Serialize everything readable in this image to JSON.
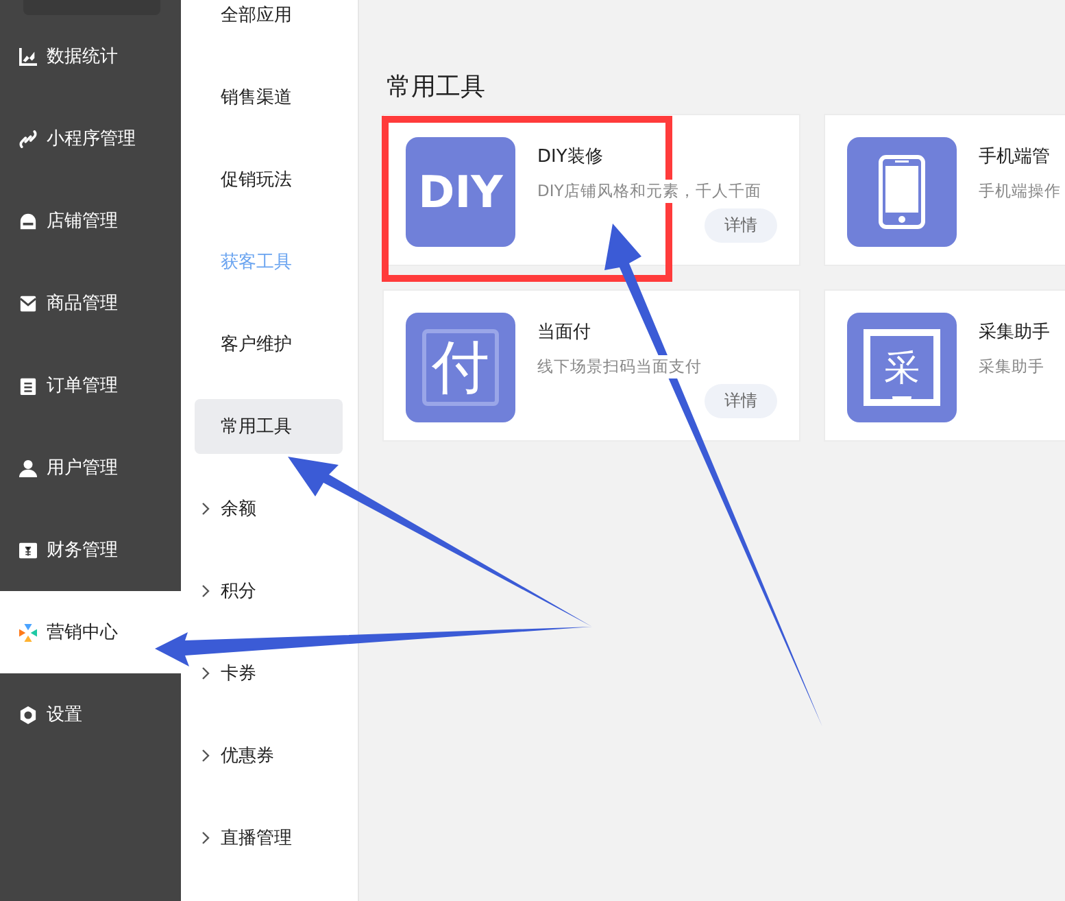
{
  "sidebar": {
    "items": [
      {
        "label": "数据统计",
        "selected": false
      },
      {
        "label": "小程序管理",
        "selected": false
      },
      {
        "label": "店铺管理",
        "selected": false
      },
      {
        "label": "商品管理",
        "selected": false
      },
      {
        "label": "订单管理",
        "selected": false
      },
      {
        "label": "用户管理",
        "selected": false
      },
      {
        "label": "财务管理",
        "selected": false
      },
      {
        "label": "营销中心",
        "selected": true
      },
      {
        "label": "设置",
        "selected": false
      }
    ]
  },
  "submenu": {
    "items": [
      {
        "label": "全部应用",
        "kind": "link",
        "selected": false,
        "highlighted": false
      },
      {
        "label": "销售渠道",
        "kind": "link",
        "selected": false,
        "highlighted": false
      },
      {
        "label": "促销玩法",
        "kind": "link",
        "selected": false,
        "highlighted": false
      },
      {
        "label": "获客工具",
        "kind": "link",
        "selected": false,
        "highlighted": true
      },
      {
        "label": "客户维护",
        "kind": "link",
        "selected": false,
        "highlighted": false
      },
      {
        "label": "常用工具",
        "kind": "link",
        "selected": true,
        "highlighted": false
      },
      {
        "label": "余额",
        "kind": "group",
        "selected": false,
        "highlighted": false
      },
      {
        "label": "积分",
        "kind": "group",
        "selected": false,
        "highlighted": false
      },
      {
        "label": "卡券",
        "kind": "group",
        "selected": false,
        "highlighted": false
      },
      {
        "label": "优惠券",
        "kind": "group",
        "selected": false,
        "highlighted": false
      },
      {
        "label": "直播管理",
        "kind": "group",
        "selected": false,
        "highlighted": false
      }
    ]
  },
  "main": {
    "title": "常用工具",
    "cards": [
      {
        "title": "DIY装修",
        "description": "DIY店铺风格和元素，千人千面",
        "icon": {
          "kind": "text",
          "text": "DIY"
        },
        "button": "详情"
      },
      {
        "title": "手机端管",
        "description": "手机端操作",
        "icon": {
          "kind": "phone"
        }
      },
      {
        "title": "当面付",
        "description": "线下场景扫码当面支付",
        "icon": {
          "kind": "frame_text",
          "text": "付"
        },
        "button": "详情"
      },
      {
        "title": "采集助手",
        "description": "采集助手",
        "icon": {
          "kind": "board_text",
          "text": "采"
        }
      }
    ]
  }
}
